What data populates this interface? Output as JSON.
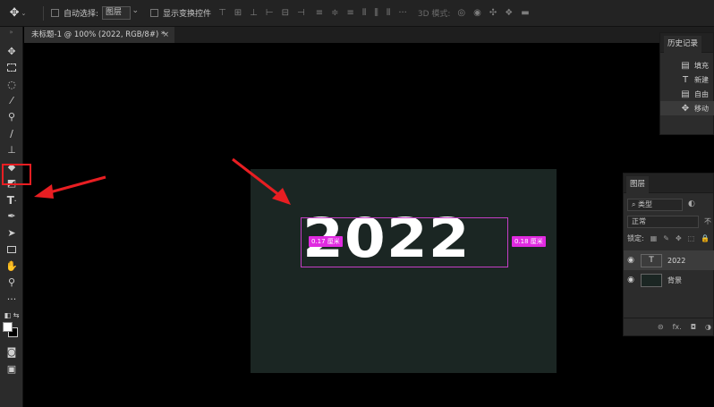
{
  "options_bar": {
    "auto_select_label": "自动选择:",
    "auto_select_target": "图层",
    "show_transform_label": "显示变换控件",
    "mode_3d_label": "3D 模式:"
  },
  "document": {
    "tab_title": "未标题-1 @ 100% (2022, RGB/8#) *",
    "close_glyph": "×",
    "canvas_text": "2022",
    "measure_left": "0.17 厘米",
    "measure_right": "0.18 厘米"
  },
  "history": {
    "title": "历史记录",
    "items": [
      {
        "icon": "▤",
        "label": "填充"
      },
      {
        "icon": "T",
        "label": "新建"
      },
      {
        "icon": "▤",
        "label": "自由"
      },
      {
        "icon": "✥",
        "label": "移动"
      }
    ]
  },
  "layers": {
    "title": "图层",
    "filter_kind": "类型",
    "blend_mode": "正常",
    "opacity_label": "不",
    "lock_label": "锁定:",
    "items": [
      {
        "name": "2022",
        "thumb": "T"
      },
      {
        "name": "背景",
        "thumb": ""
      }
    ],
    "footer_fx": "fx."
  },
  "colors": {
    "canvas_bg": "#1b2623",
    "highlight_red": "#e81e22",
    "measure_magenta": "#e02ae0"
  }
}
